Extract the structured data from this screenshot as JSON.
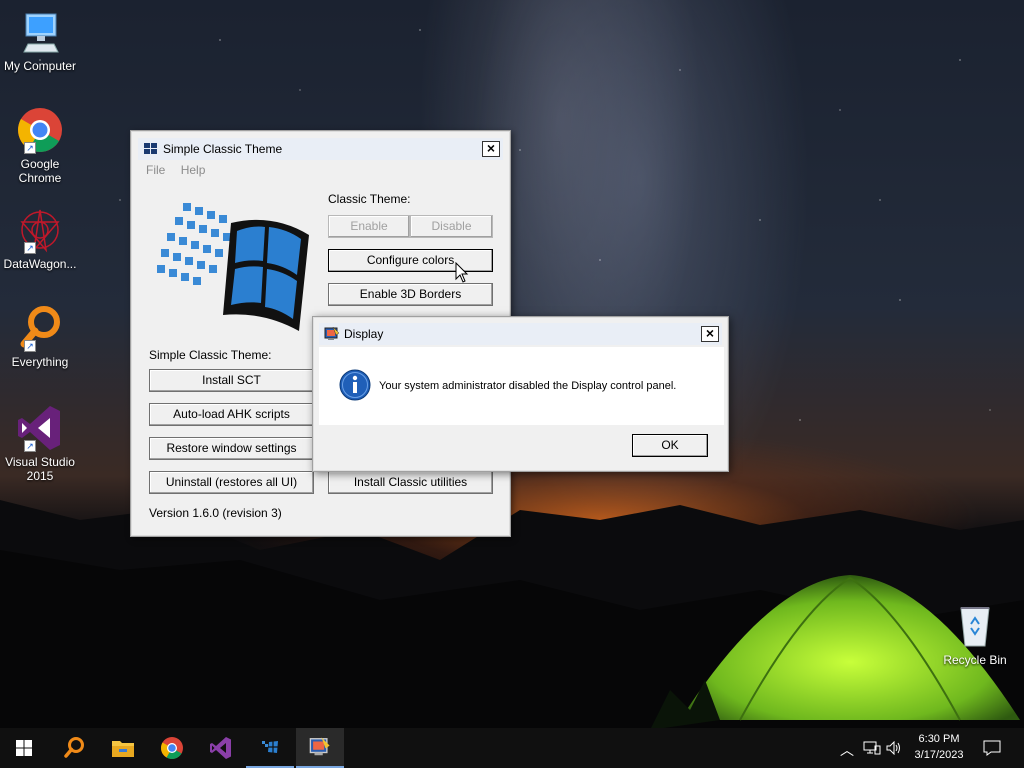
{
  "desktop": {
    "icons": [
      {
        "label": "My Computer"
      },
      {
        "label": "Google Chrome"
      },
      {
        "label": "DataWagon..."
      },
      {
        "label": "Everything"
      },
      {
        "label": "Visual Studio 2015"
      },
      {
        "label": "Recycle Bin"
      }
    ]
  },
  "sct_window": {
    "title": "Simple Classic Theme",
    "menu": [
      "File",
      "Help"
    ],
    "classic_theme_label": "Classic Theme:",
    "enable_label": "Enable",
    "disable_label": "Disable",
    "configure_colors_label": "Configure colors",
    "enable_3d_borders_label": "Enable 3D Borders",
    "sct_label": "Simple Classic Theme:",
    "install_sct_label": "Install SCT",
    "autoload_ahk_label": "Auto-load AHK scripts",
    "restore_window_label": "Restore window settings",
    "uninstall_label": "Uninstall (restores all UI)",
    "install_classic_utilities_label": "Install Classic utilities",
    "version_text": "Version 1.6.0 (revision 3)"
  },
  "display_dialog": {
    "title": "Display",
    "message": "Your system administrator disabled the Display control panel.",
    "ok_label": "OK"
  },
  "taskbar": {
    "time": "6:30 PM",
    "date": "3/17/2023",
    "pinned": [
      "start-icon",
      "everything-icon",
      "file-explorer-icon",
      "chrome-icon",
      "visual-studio-icon",
      "sct-icon",
      "display-icon"
    ]
  },
  "colors": {
    "dialog_title_bg": "#ffffff",
    "info_icon": "#1f5fb8",
    "taskbar_bg": "#101010"
  }
}
